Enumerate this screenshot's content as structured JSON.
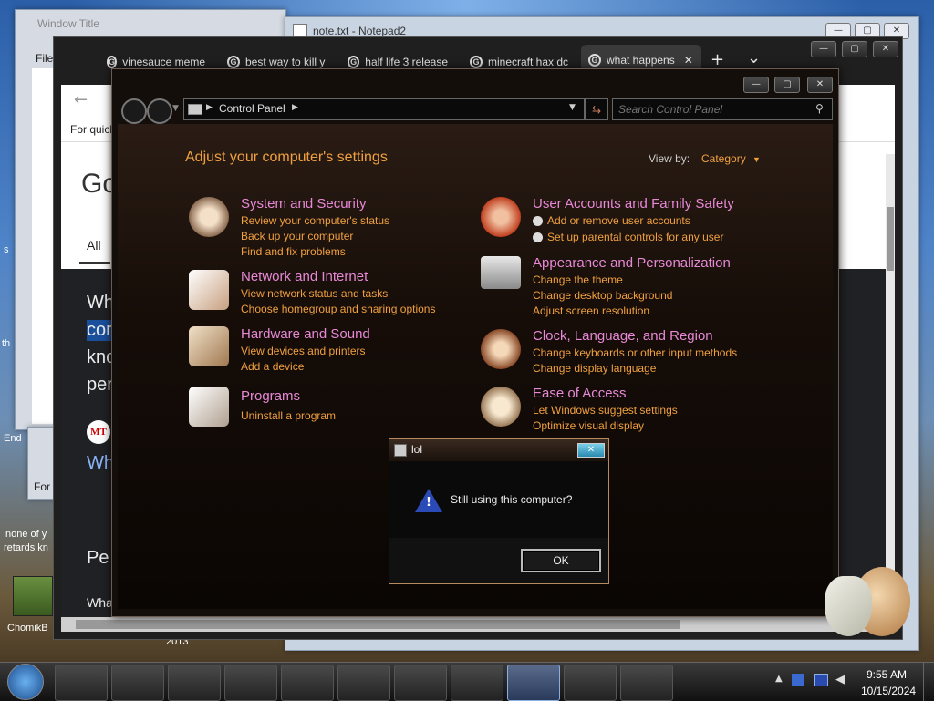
{
  "background_windows": {
    "notepad_title": "note.txt - Notepad2",
    "back_left_title": "Window Title",
    "file_menu": "File",
    "for_quick": "For quick",
    "for_k": "For k",
    "end_text": "End",
    "s_text": "s",
    "th_text": "th",
    "none_text": "none of y",
    "retards_text": "retards kn",
    "chomik_label": "ChomikB",
    "year_text": "2013"
  },
  "browser": {
    "tabs": [
      {
        "label": "vinesauce meme"
      },
      {
        "label": "best way to kill y"
      },
      {
        "label": "half life 3 release"
      },
      {
        "label": "minecraft hax dc"
      },
      {
        "label": "what happens"
      }
    ],
    "new_tab": "+",
    "tab_menu": "⌄",
    "for_quick": "For quick",
    "google_partial": "Go",
    "all_tab": "All",
    "q1": "Wh",
    "q2": "cor",
    "q3": "kno",
    "q4": "per",
    "mt": "MT",
    "wh_link": "Wh",
    "pe": "Pe",
    "wha": "Wha"
  },
  "control_panel": {
    "breadcrumb": "Control Panel",
    "search_placeholder": "Search Control Panel",
    "heading": "Adjust your computer's settings",
    "view_by_label": "View by:",
    "view_by_value": "Category",
    "categories": [
      {
        "title": "System and Security",
        "links": [
          "Review your computer's status",
          "Back up your computer",
          "Find and fix problems"
        ]
      },
      {
        "title": "Network and Internet",
        "links": [
          "View network status and tasks",
          "Choose homegroup and sharing options"
        ]
      },
      {
        "title": "Hardware and Sound",
        "links": [
          "View devices and printers",
          "Add a device"
        ]
      },
      {
        "title": "Programs",
        "links": [
          "Uninstall a program"
        ]
      },
      {
        "title": "User Accounts and Family Safety",
        "links": [
          "Add or remove user accounts",
          "Set up parental controls for any user"
        ]
      },
      {
        "title": "Appearance and Personalization",
        "links": [
          "Change the theme",
          "Change desktop background",
          "Adjust screen resolution"
        ]
      },
      {
        "title": "Clock, Language, and Region",
        "links": [
          "Change keyboards or other input methods",
          "Change display language"
        ]
      },
      {
        "title": "Ease of Access",
        "links": [
          "Let Windows suggest settings",
          "Optimize visual display"
        ]
      }
    ]
  },
  "dialog": {
    "title": "lol",
    "message": "Still using this computer?",
    "ok": "OK",
    "close": "✕"
  },
  "taskbar": {
    "time": "9:55 AM",
    "date": "10/15/2024"
  },
  "colors": {
    "link_orange": "#f0a040",
    "title_pink": "#e789d6",
    "heading_orange": "#f0a040"
  }
}
